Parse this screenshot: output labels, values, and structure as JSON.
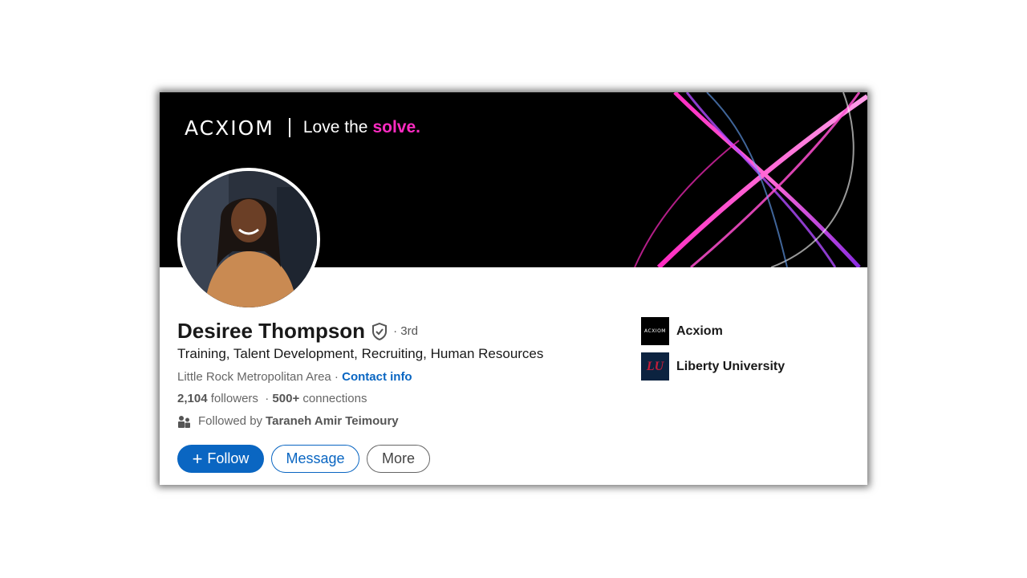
{
  "banner": {
    "logo_text": "ACXIOM",
    "tagline": "Love the",
    "tagline_accent": "solve.",
    "accent_color": "#ff2bc2"
  },
  "profile": {
    "name": "Desiree Thompson",
    "degree": "· 3rd",
    "headline": "Training, Talent Development, Recruiting, Human Resources",
    "location": "Little Rock Metropolitan Area ·",
    "contact_link": "Contact info",
    "followers_count": "2,104",
    "followers_label": "followers",
    "connections_prefix": "·",
    "connections_count": "500+",
    "connections_label": "connections",
    "followed_by_prefix": "Followed by",
    "followed_by_name": "Taraneh Amir Teimoury"
  },
  "actions": {
    "follow_label": "Follow",
    "message_label": "Message",
    "more_label": "More"
  },
  "side": {
    "items": [
      {
        "logo_text": "ACXIOM",
        "label": "Acxiom"
      },
      {
        "logo_text": "LU",
        "label": "Liberty University"
      }
    ]
  },
  "colors": {
    "primary": "#0a66c2",
    "banner_bg": "#000000"
  }
}
